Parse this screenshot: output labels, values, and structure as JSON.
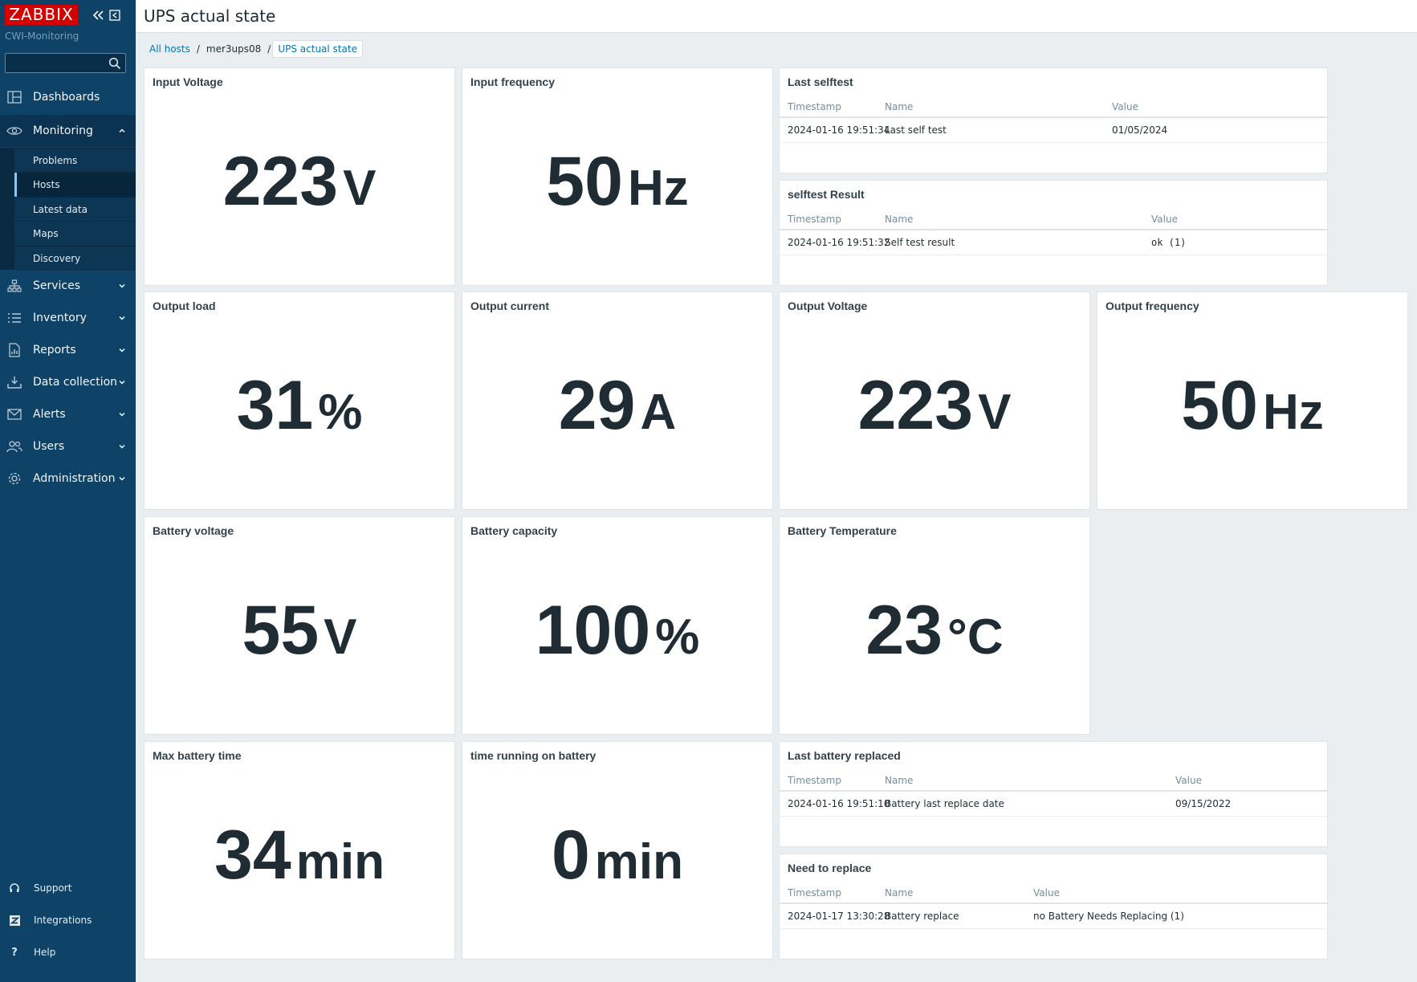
{
  "sidebar": {
    "logo": "ZABBIX",
    "org": "CWI-Monitoring",
    "search_placeholder": "",
    "nav": {
      "dashboards": "Dashboards",
      "monitoring": "Monitoring",
      "services": "Services",
      "inventory": "Inventory",
      "reports": "Reports",
      "data_collection": "Data collection",
      "alerts": "Alerts",
      "users": "Users",
      "administration": "Administration"
    },
    "submenu": {
      "problems": "Problems",
      "hosts": "Hosts",
      "latest_data": "Latest data",
      "maps": "Maps",
      "discovery": "Discovery"
    },
    "footer": {
      "support": "Support",
      "integrations": "Integrations",
      "help": "Help"
    }
  },
  "header": {
    "title": "UPS actual state"
  },
  "breadcrumb": {
    "all_hosts": "All hosts",
    "host": "mer3ups08",
    "current": "UPS actual state"
  },
  "widgets": {
    "input_voltage": {
      "title": "Input Voltage",
      "value": "223",
      "unit": "V"
    },
    "input_frequency": {
      "title": "Input frequency",
      "value": "50",
      "unit": "Hz"
    },
    "output_load": {
      "title": "Output load",
      "value": "31",
      "unit": "%"
    },
    "output_current": {
      "title": "Output current",
      "value": "29",
      "unit": "A"
    },
    "output_voltage": {
      "title": "Output Voltage",
      "value": "223",
      "unit": "V"
    },
    "output_frequency": {
      "title": "Output frequency",
      "value": "50",
      "unit": "Hz"
    },
    "battery_voltage": {
      "title": "Battery voltage",
      "value": "55",
      "unit": "V"
    },
    "battery_capacity": {
      "title": "Battery capacity",
      "value": "100",
      "unit": "%"
    },
    "battery_temperature": {
      "title": "Battery Temperature",
      "value": "23",
      "unit": "°C"
    },
    "max_battery_time": {
      "title": "Max battery time",
      "value": "34",
      "unit": "min"
    },
    "time_on_battery": {
      "title": "time running on battery",
      "value": "0",
      "unit": "min"
    }
  },
  "tables": {
    "headers": {
      "timestamp": "Timestamp",
      "name": "Name",
      "value": "Value"
    },
    "last_selftest": {
      "title": "Last selftest",
      "timestamp": "2024-01-16 19:51:34",
      "name": "Last self test",
      "value": "01/05/2024"
    },
    "selftest_result": {
      "title": "selftest Result",
      "timestamp": "2024-01-16 19:51:32",
      "name": "Self test result",
      "value": "ok (1)"
    },
    "last_battery_replaced": {
      "title": "Last battery replaced",
      "timestamp": "2024-01-16 19:51:10",
      "name": "Battery last replace date",
      "value": "09/15/2022"
    },
    "need_to_replace": {
      "title": "Need to replace",
      "timestamp": "2024-01-17 13:30:28",
      "name": "Battery replace",
      "value": "no Battery Needs Replacing (1)"
    }
  }
}
